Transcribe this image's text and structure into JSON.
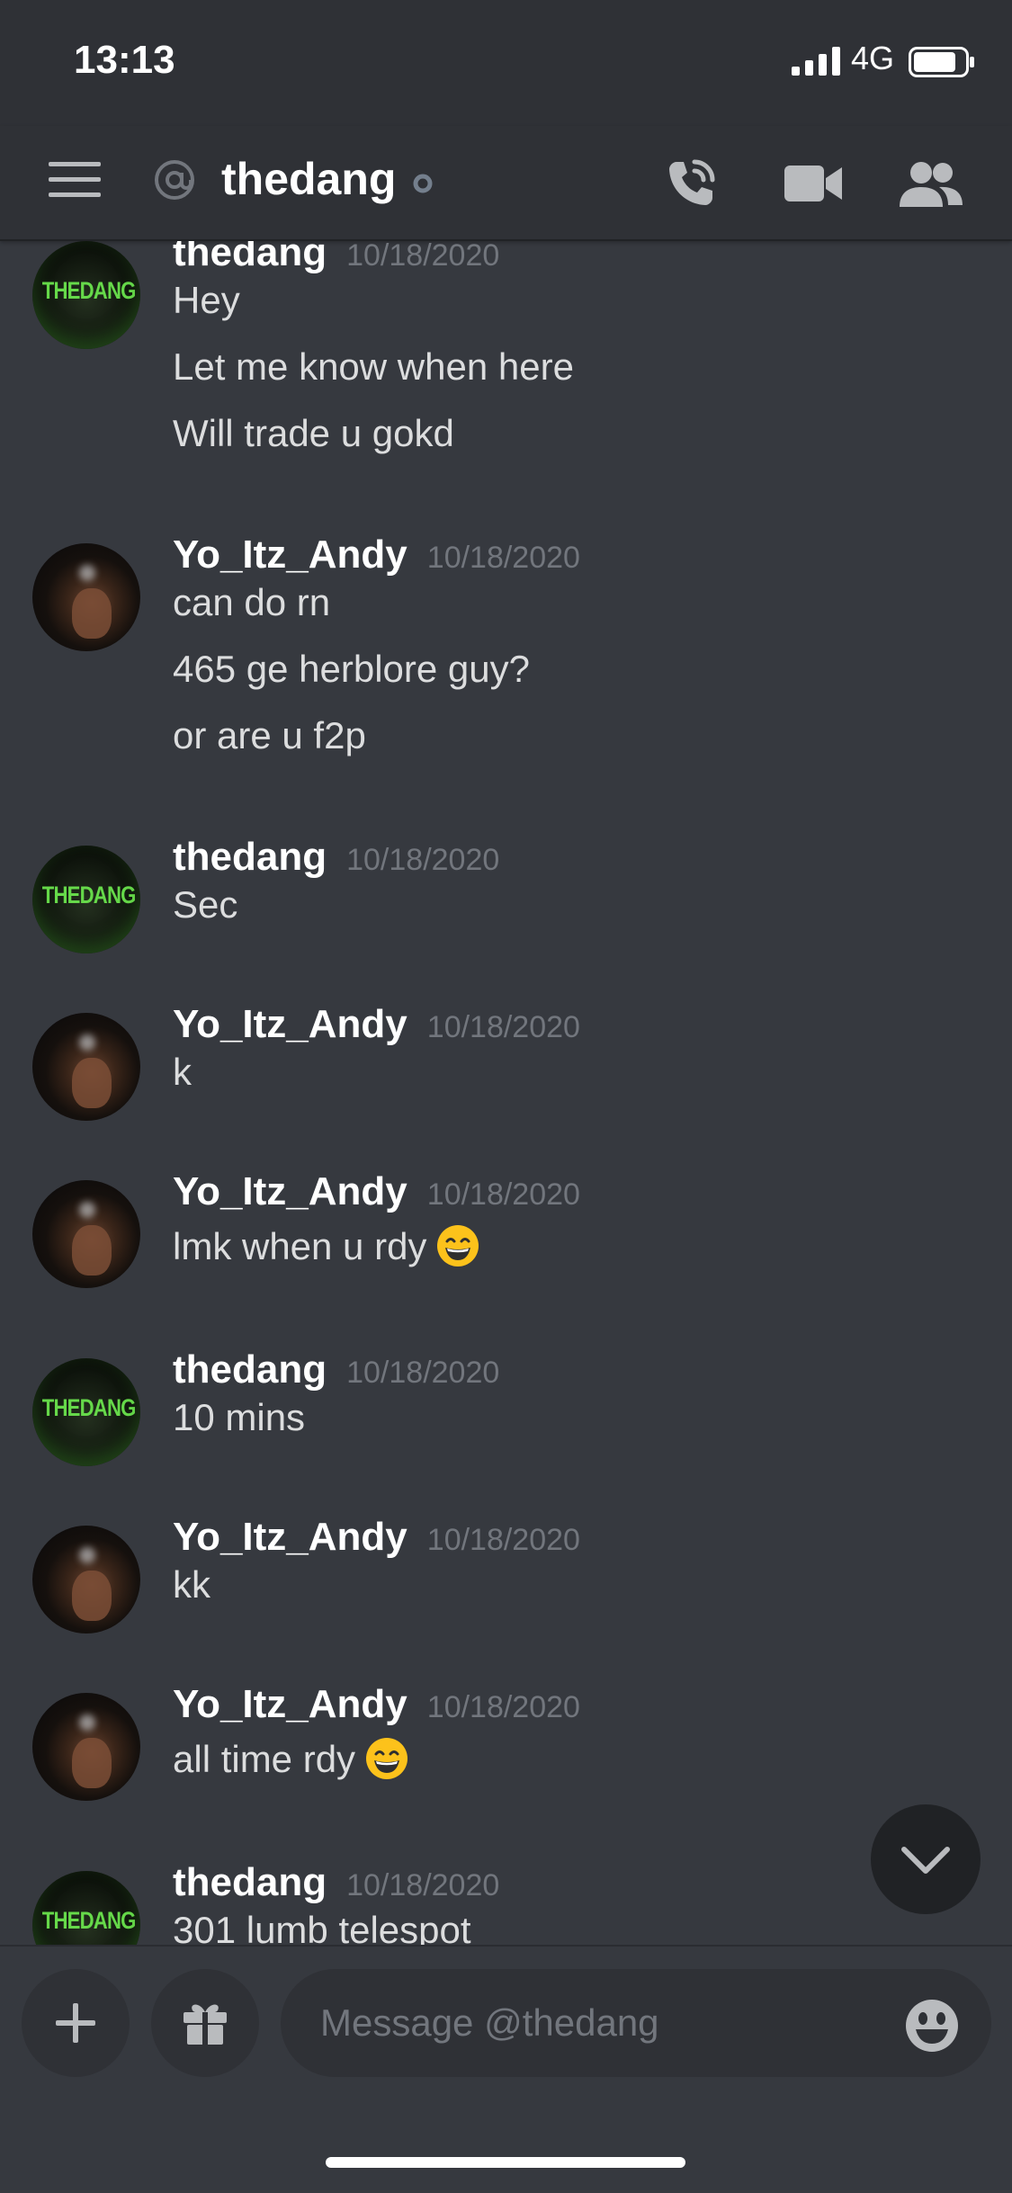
{
  "status_bar": {
    "time": "13:13",
    "network": "4G"
  },
  "header": {
    "channel_name": "thedang"
  },
  "messages": [
    {
      "author": "thedang",
      "timestamp": "10/18/2020",
      "lines": [
        "Hey",
        "Let me know when here",
        "Will trade u gokd"
      ]
    },
    {
      "author": "Yo_Itz_Andy",
      "timestamp": "10/18/2020",
      "lines": [
        "can do rn",
        "465 ge herblore guy?",
        "or are u f2p"
      ]
    },
    {
      "author": "thedang",
      "timestamp": "10/18/2020",
      "lines": [
        "Sec"
      ]
    },
    {
      "author": "Yo_Itz_Andy",
      "timestamp": "10/18/2020",
      "lines": [
        "k"
      ]
    },
    {
      "author": "Yo_Itz_Andy",
      "timestamp": "10/18/2020",
      "lines": [
        "lmk when u rdy"
      ],
      "emoji": "grinning-face-emoji"
    },
    {
      "author": "thedang",
      "timestamp": "10/18/2020",
      "lines": [
        "10 mins"
      ]
    },
    {
      "author": "Yo_Itz_Andy",
      "timestamp": "10/18/2020",
      "lines": [
        "kk"
      ]
    },
    {
      "author": "Yo_Itz_Andy",
      "timestamp": "10/18/2020",
      "lines": [
        "all time rdy"
      ],
      "emoji": "grinning-face-emoji"
    },
    {
      "author": "thedang",
      "timestamp": "10/18/2020",
      "lines": [
        "301 lumb telespot"
      ]
    }
  ],
  "avatars": {
    "thedang_text": "THEDANG"
  },
  "composer": {
    "placeholder": "Message @thedang"
  },
  "colors": {
    "background": "#36393f",
    "header": "#2f3136",
    "accent_text": "#ffffff",
    "muted_text": "#72767d",
    "avatar_green": "#66d94a"
  },
  "icons": [
    "hamburger-menu-icon",
    "at-sign-icon",
    "status-dot-icon",
    "voice-call-icon",
    "video-camera-icon",
    "members-icon",
    "chevron-down-icon",
    "plus-icon",
    "gift-icon",
    "emoji-icon"
  ]
}
